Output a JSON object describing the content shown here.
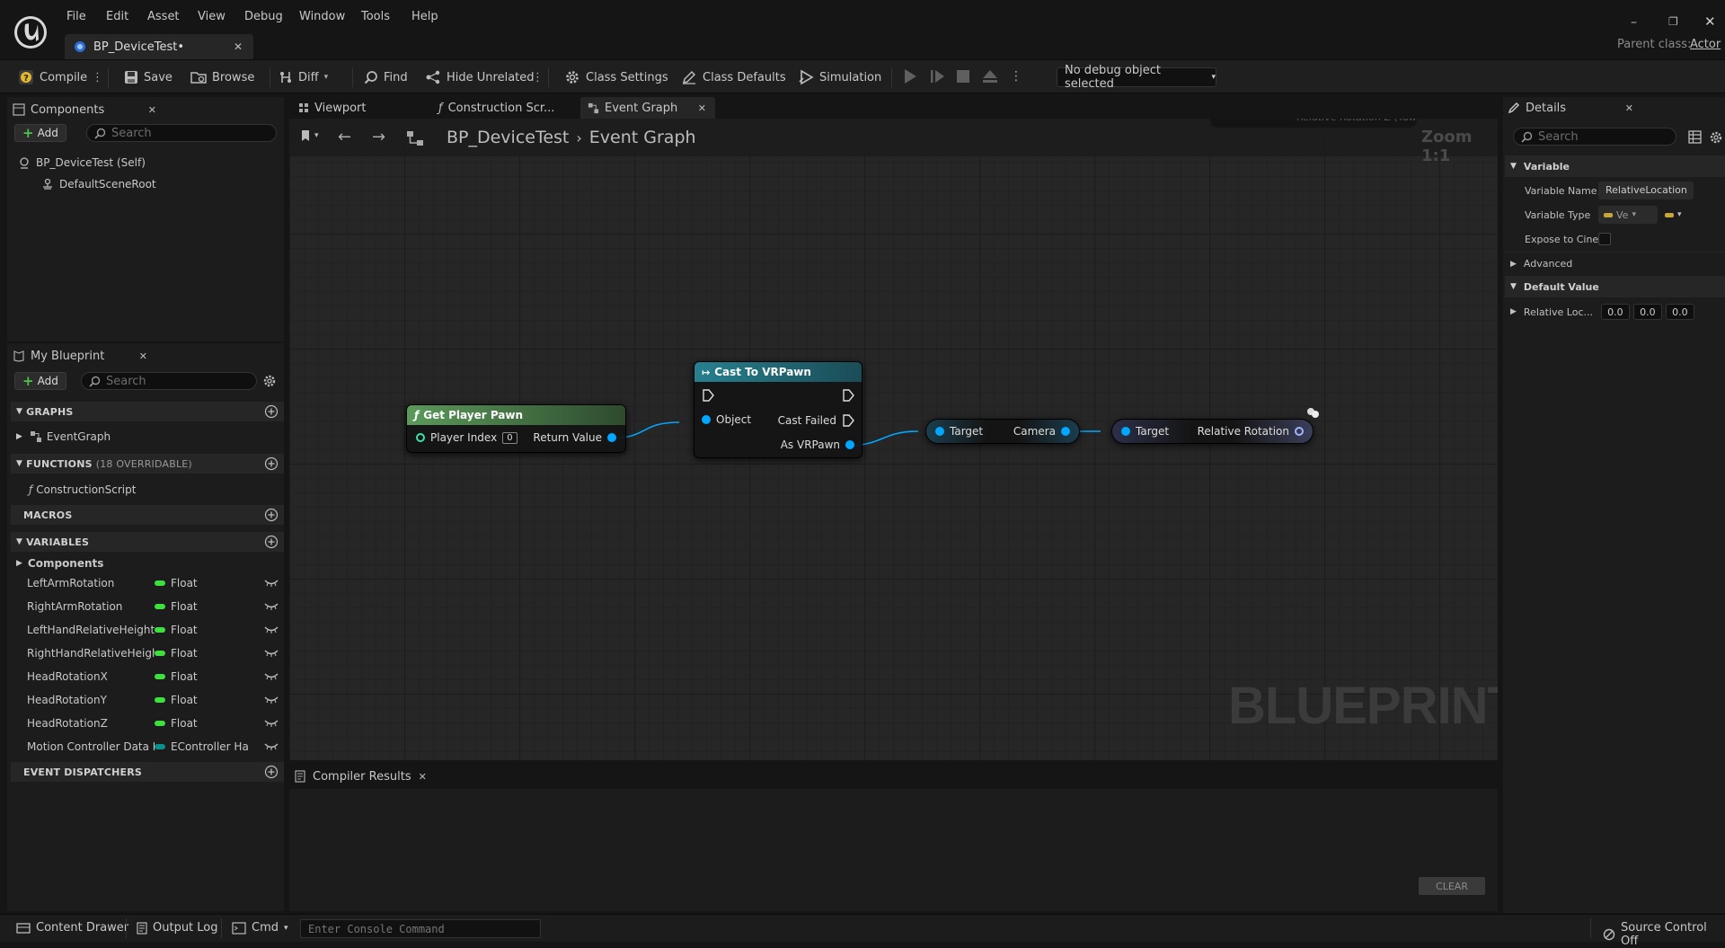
{
  "app": {
    "menu": [
      "File",
      "Edit",
      "Asset",
      "View",
      "Debug",
      "Window",
      "Tools",
      "Help"
    ],
    "doc_tab": "BP_DeviceTest•",
    "parent_class_label": "Parent class:",
    "parent_class_value": "Actor"
  },
  "toolbar": {
    "compile": "Compile",
    "save": "Save",
    "browse": "Browse",
    "diff": "Diff",
    "find": "Find",
    "hide_unrelated": "Hide Unrelated",
    "class_settings": "Class Settings",
    "class_defaults": "Class Defaults",
    "simulation": "Simulation",
    "debug_object": "No debug object selected"
  },
  "components": {
    "tab": "Components",
    "add": "Add",
    "search_placeholder": "Search",
    "items": [
      "BP_DeviceTest (Self)",
      "DefaultSceneRoot"
    ]
  },
  "my_blueprint": {
    "tab": "My Blueprint",
    "add": "Add",
    "search_placeholder": "Search",
    "graphs_label": "GRAPHS",
    "graphs": [
      "EventGraph"
    ],
    "functions_label": "FUNCTIONS",
    "functions_note": "(18 OVERRIDABLE)",
    "functions": [
      "ConstructionScript"
    ],
    "macros_label": "MACROS",
    "variables_label": "VARIABLES",
    "components_group": "Components",
    "variables": [
      {
        "name": "LeftArmRotation",
        "type": "Float",
        "color": "#3ee03e"
      },
      {
        "name": "RightArmRotation",
        "type": "Float",
        "color": "#3ee03e"
      },
      {
        "name": "LeftHandRelativeHeight",
        "type": "Float",
        "color": "#3ee03e"
      },
      {
        "name": "RightHandRelativeHeight",
        "type": "Float",
        "color": "#3ee03e"
      },
      {
        "name": "HeadRotationX",
        "type": "Float",
        "color": "#3ee03e"
      },
      {
        "name": "HeadRotationY",
        "type": "Float",
        "color": "#3ee03e"
      },
      {
        "name": "HeadRotationZ",
        "type": "Float",
        "color": "#3ee03e"
      },
      {
        "name": "Motion Controller Data Han",
        "type": "EController Ha",
        "color": "#0a8f8a"
      }
    ],
    "event_dispatchers_label": "EVENT DISPATCHERS"
  },
  "editor_tabs": [
    "Viewport",
    "Construction Scr...",
    "Event Graph"
  ],
  "breadcrumb": {
    "blueprint": "BP_DeviceTest",
    "graph": "Event Graph"
  },
  "graph": {
    "zoom": "Zoom 1:1",
    "watermark": "BLUEPRINT",
    "top_clip_text": "Relative Rotation Z (Yaw)",
    "nodes": {
      "get_player_pawn": {
        "title": "Get Player Pawn",
        "in": "Player Index",
        "in_value": "0",
        "out": "Return Value"
      },
      "cast": {
        "title": "Cast To VRPawn",
        "in": "Object",
        "out1": "Cast Failed",
        "out2": "As VRPawn"
      },
      "camera": {
        "in": "Target",
        "out": "Camera"
      },
      "rel_rot": {
        "in": "Target",
        "out": "Relative Rotation"
      }
    }
  },
  "compiler": {
    "tab": "Compiler Results",
    "clear": "CLEAR"
  },
  "details": {
    "tab": "Details",
    "search_placeholder": "Search",
    "variable_section": "Variable",
    "variable_name_label": "Variable Name",
    "variable_name_value": "RelativeLocation",
    "variable_type_label": "Variable Type",
    "variable_type_value": "Ve",
    "expose_label": "Expose to Cine",
    "advanced": "Advanced",
    "default_section": "Default Value",
    "rel_loc_label": "Relative Loc...",
    "values": [
      "0.0",
      "0.0",
      "0.0"
    ]
  },
  "status": {
    "content_drawer": "Content Drawer",
    "output_log": "Output Log",
    "cmd": "Cmd",
    "console_placeholder": "Enter Console Command",
    "source_control": "Source Control Off"
  },
  "colors": {
    "accent": "#00a8ff",
    "pure_header": "#4d8c4d",
    "cast_header": "#1e6e80",
    "float": "#3ee03e"
  }
}
